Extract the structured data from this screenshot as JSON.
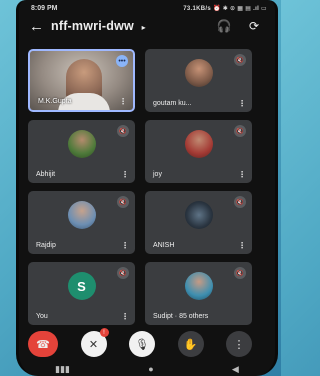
{
  "status": {
    "time": "8:09 PM",
    "right": "73.1KB/s ⏰ ✱ ⊙ ▦ ▤ .ıl ▭"
  },
  "header": {
    "back": "←",
    "title": "nff-mwri-dww",
    "caret": "▸",
    "headphone_icon": "🎧",
    "switch_icon": "⟳"
  },
  "tiles": [
    {
      "name": "M.K.Gupta",
      "menu": "⋮",
      "speaking": "•••"
    },
    {
      "name": "goutam ku...",
      "menu": "⋮",
      "mute": "🔇"
    },
    {
      "name": "Abhijit",
      "menu": "⋮",
      "mute": "🔇"
    },
    {
      "name": "joy",
      "menu": "⋮",
      "mute": "🔇"
    },
    {
      "name": "Rajdip",
      "menu": "⋮",
      "mute": "🔇"
    },
    {
      "name": "ANISH",
      "menu": "⋮",
      "mute": "🔇"
    },
    {
      "name": "You",
      "initial": "S",
      "menu": "⋮",
      "mute": "🔇"
    },
    {
      "name": "Sudipt · 85 others",
      "mute": "🔇"
    }
  ],
  "controls": {
    "end_call": "☎",
    "camera": "✕",
    "camera_badge": "!",
    "mic": "🎙",
    "hand": "✋",
    "more": "⋮"
  },
  "navbar": {
    "recent": "▮▮▮",
    "home": "●",
    "back": "◀"
  }
}
